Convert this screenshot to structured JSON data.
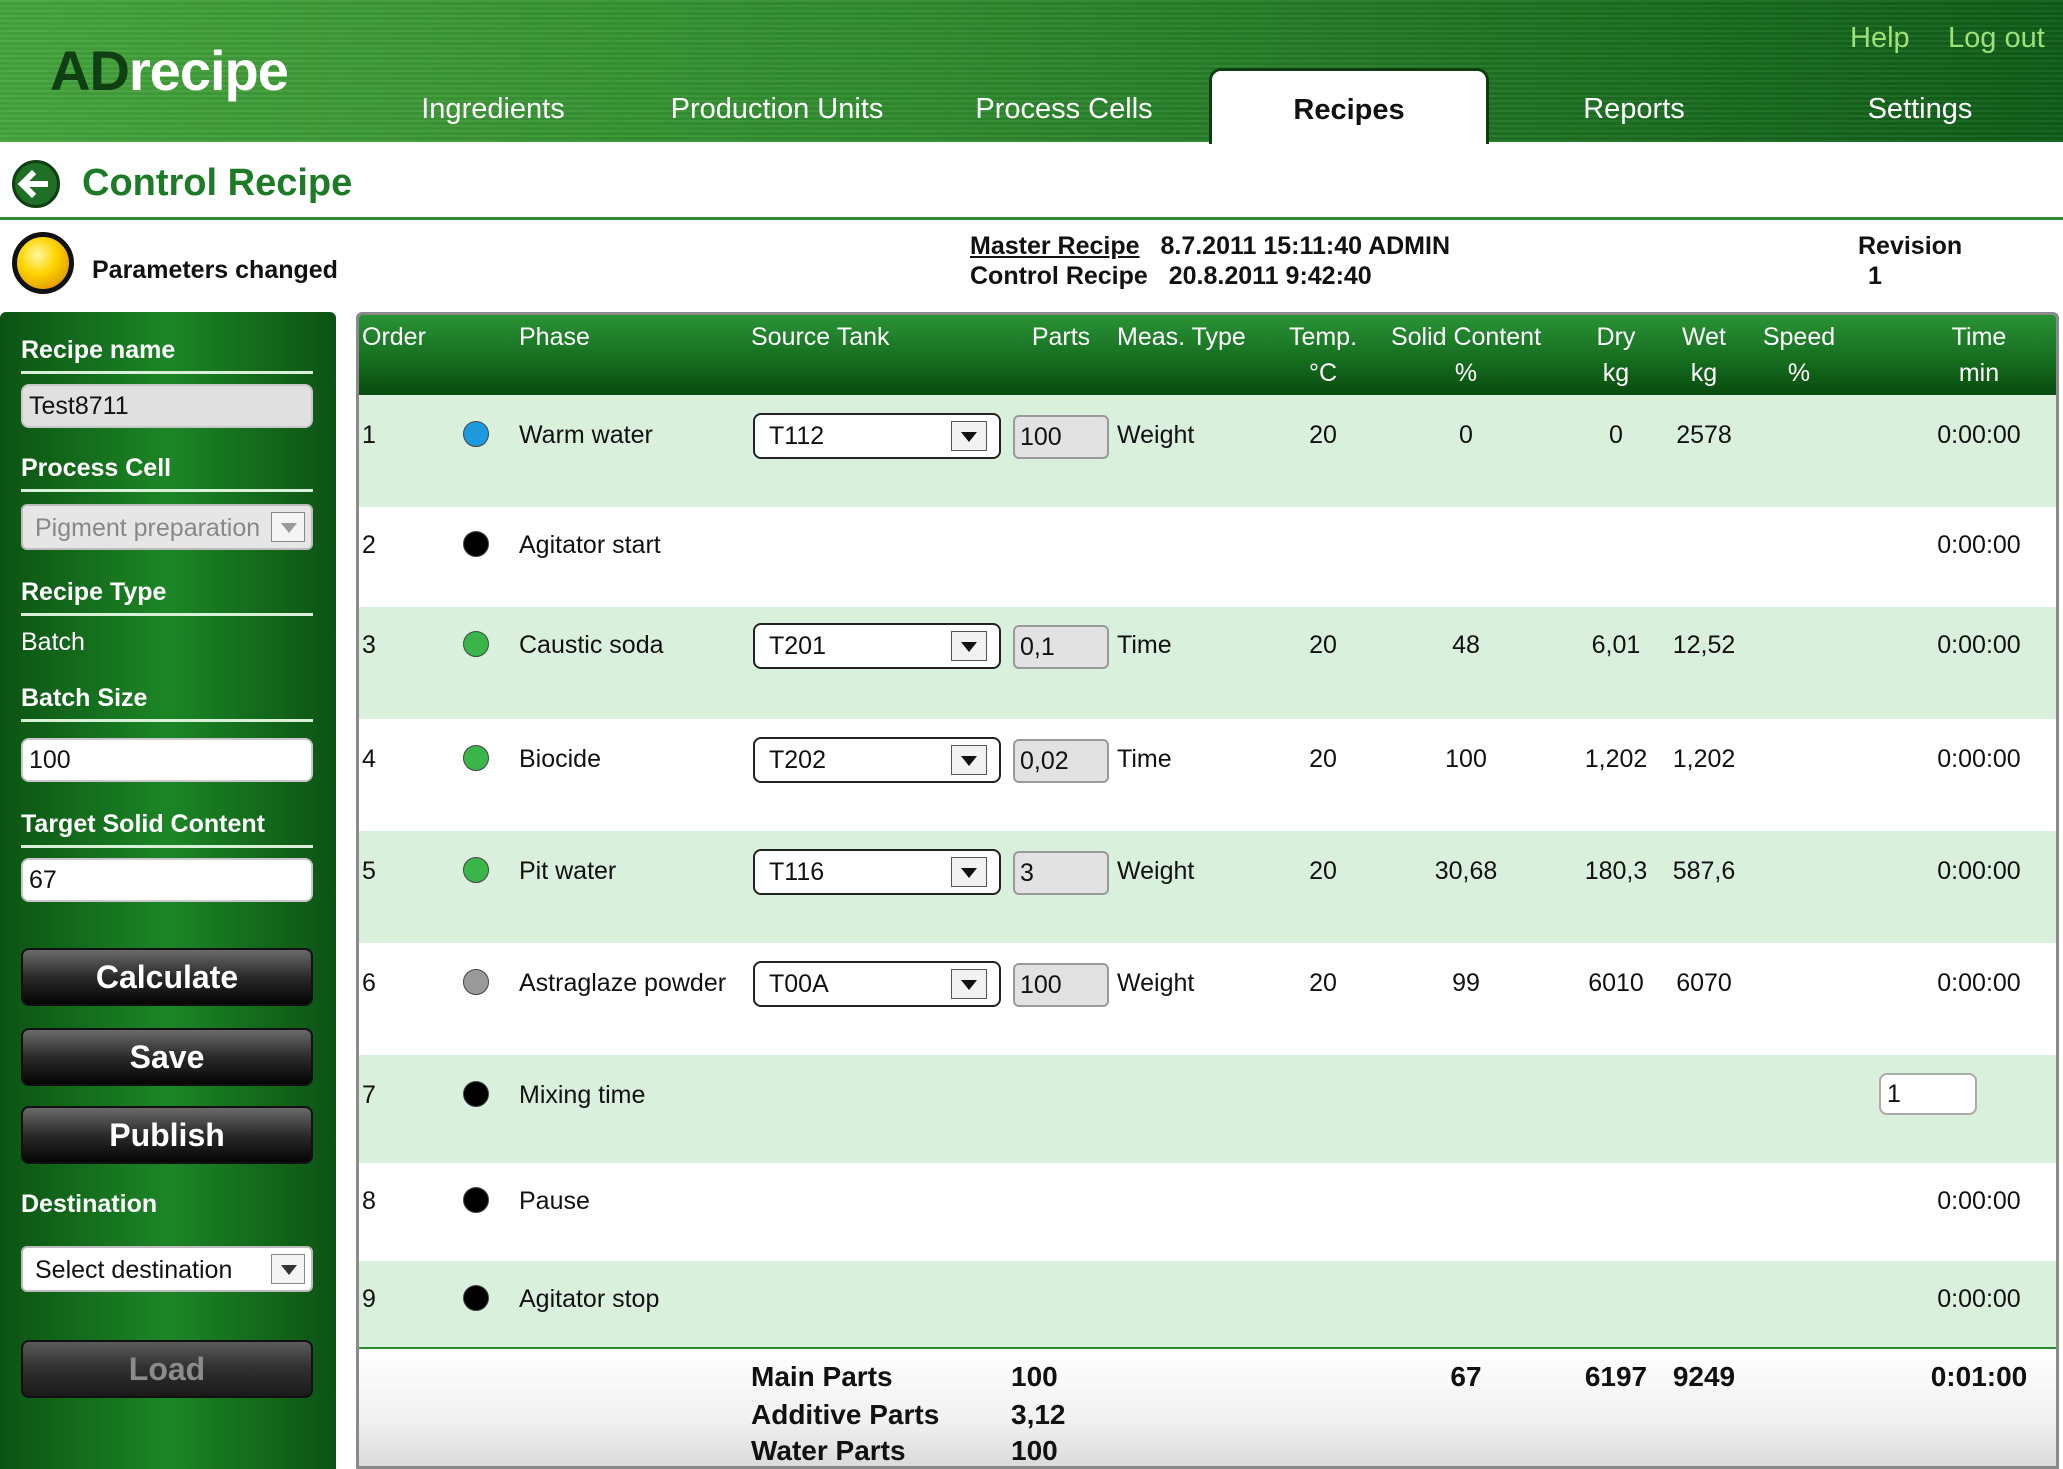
{
  "header": {
    "logo_ad": "AD",
    "logo_rest": "recipe",
    "help": "Help",
    "logout": "Log out",
    "tabs": [
      "Ingredients",
      "Production Units",
      "Process Cells",
      "Recipes",
      "Reports",
      "Settings"
    ],
    "active_tab": "Recipes"
  },
  "page": {
    "title": "Control Recipe",
    "status": "Parameters changed",
    "status_color": "#ffd400"
  },
  "meta": {
    "master_label": "Master Recipe",
    "master_value": "8.7.2011 15:11:40  ADMIN",
    "control_label": "Control Recipe",
    "control_value": "20.8.2011 9:42:40",
    "revision_label": "Revision",
    "revision_value": "1"
  },
  "sidebar": {
    "recipe_name_label": "Recipe name",
    "recipe_name": "Test8711",
    "process_cell_label": "Process Cell",
    "process_cell": "Pigment preparation",
    "recipe_type_label": "Recipe Type",
    "recipe_type": "Batch",
    "batch_size_label": "Batch Size",
    "batch_size": "100",
    "target_solid_label": "Target Solid Content",
    "target_solid": "67",
    "calculate": "Calculate",
    "save": "Save",
    "publish": "Publish",
    "destination_label": "Destination",
    "destination": "Select destination",
    "load": "Load"
  },
  "table": {
    "headers": {
      "order": "Order",
      "phase": "Phase",
      "source_tank": "Source Tank",
      "parts": "Parts",
      "meas_type": "Meas. Type",
      "temp": "Temp.",
      "temp_unit": "°C",
      "solid": "Solid Content",
      "solid_unit": "%",
      "dry": "Dry",
      "dry_unit": "kg",
      "wet": "Wet",
      "wet_unit": "kg",
      "speed": "Speed",
      "speed_unit": "%",
      "time": "Time",
      "time_unit": "min"
    },
    "rows": [
      {
        "order": "1",
        "phase": "Warm water",
        "dot": "#1e9be0",
        "tank": "T112",
        "parts": "100",
        "meas": "Weight",
        "temp": "20",
        "solid": "0",
        "dry": "0",
        "wet": "2578",
        "time": "0:00:00"
      },
      {
        "order": "2",
        "phase": "Agitator start",
        "dot": "#000000",
        "time": "0:00:00"
      },
      {
        "order": "3",
        "phase": "Caustic soda",
        "dot": "#3ab54a",
        "tank": "T201",
        "parts": "0,1",
        "meas": "Time",
        "temp": "20",
        "solid": "48",
        "dry": "6,01",
        "wet": "12,52",
        "time": "0:00:00"
      },
      {
        "order": "4",
        "phase": "Biocide",
        "dot": "#3ab54a",
        "tank": "T202",
        "parts": "0,02",
        "meas": "Time",
        "temp": "20",
        "solid": "100",
        "dry": "1,202",
        "wet": "1,202",
        "time": "0:00:00"
      },
      {
        "order": "5",
        "phase": "Pit water",
        "dot": "#3ab54a",
        "tank": "T116",
        "parts": "3",
        "meas": "Weight",
        "temp": "20",
        "solid": "30,68",
        "dry": "180,3",
        "wet": "587,6",
        "time": "0:00:00"
      },
      {
        "order": "6",
        "phase": "Astraglaze powder",
        "dot": "#9a9a9a",
        "tank": "T00A",
        "parts": "100",
        "meas": "Weight",
        "temp": "20",
        "solid": "99",
        "dry": "6010",
        "wet": "6070",
        "time": "0:00:00"
      },
      {
        "order": "7",
        "phase": "Mixing time",
        "dot": "#000000",
        "time_input": "1"
      },
      {
        "order": "8",
        "phase": "Pause",
        "dot": "#000000",
        "time": "0:00:00"
      },
      {
        "order": "9",
        "phase": "Agitator stop",
        "dot": "#000000",
        "time": "0:00:00"
      }
    ],
    "footer": {
      "main_parts_label": "Main Parts",
      "main_parts": "100",
      "additive_parts_label": "Additive Parts",
      "additive_parts": "3,12",
      "water_parts_label": "Water Parts",
      "water_parts": "100",
      "solid_total": "67",
      "dry_total": "6197",
      "wet_total": "9249",
      "time_total": "0:01:00"
    }
  }
}
